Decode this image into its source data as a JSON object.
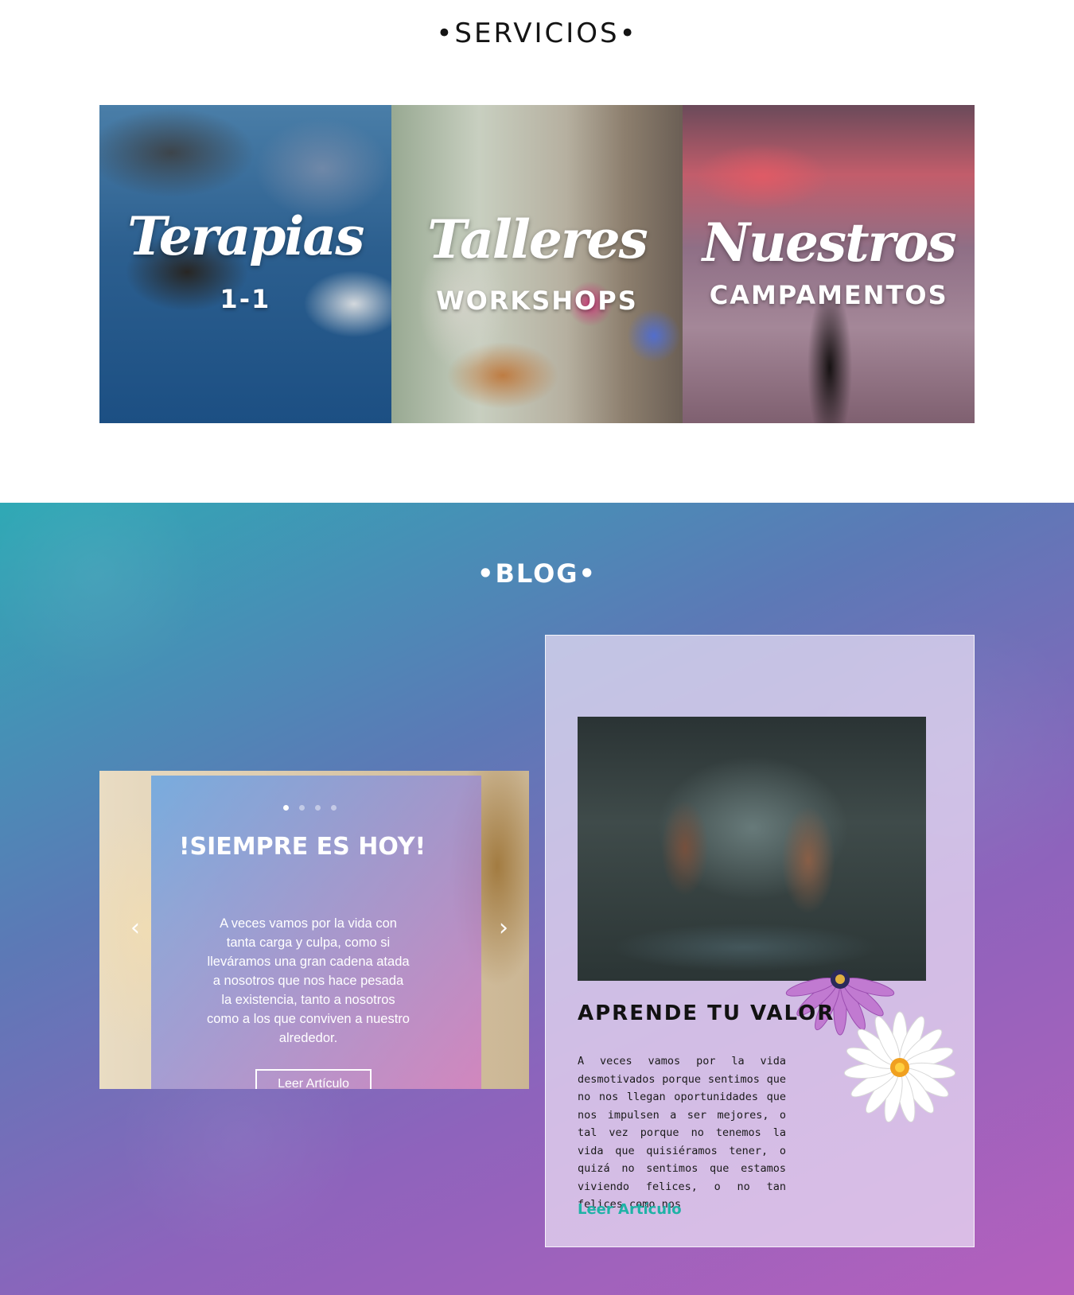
{
  "servicios": {
    "title": "•SERVICIOS•",
    "tiles": [
      {
        "script": "Terapias",
        "sub": "1-1"
      },
      {
        "script": "Talleres",
        "sub": "WORKSHOPS"
      },
      {
        "script": "Nuestros",
        "sub": "CAMPAMENTOS"
      }
    ]
  },
  "blog": {
    "title": "•BLOG•",
    "slider": {
      "title": "!SIEMPRE ES HOY!",
      "text": "A veces vamos por la vida con tanta carga y culpa, como si lleváramos una gran cadena atada a nosotros que nos hace pesada la existencia, tanto a nosotros como a los que conviven a nuestro alrededor.",
      "button": "Leer Artículo",
      "prev_icon": "‹",
      "next_icon": "›",
      "dots_count": 4,
      "active_dot": 0
    },
    "card": {
      "title": "APRENDE TU VALOR",
      "text": "A veces vamos por la vida desmotivados porque sentimos que no nos llegan oportunidades que nos impulsen a ser mejores, o tal vez porque no tenemos la vida que quisiéramos tener, o quizá no sentimos que estamos viviendo felices, o no tan felices como nos",
      "link": "Leer Artículo"
    }
  },
  "colors": {
    "accent_link": "#1fb2a6",
    "blog_gradient_start": "#2fa9b5",
    "blog_gradient_end": "#b560bd"
  }
}
